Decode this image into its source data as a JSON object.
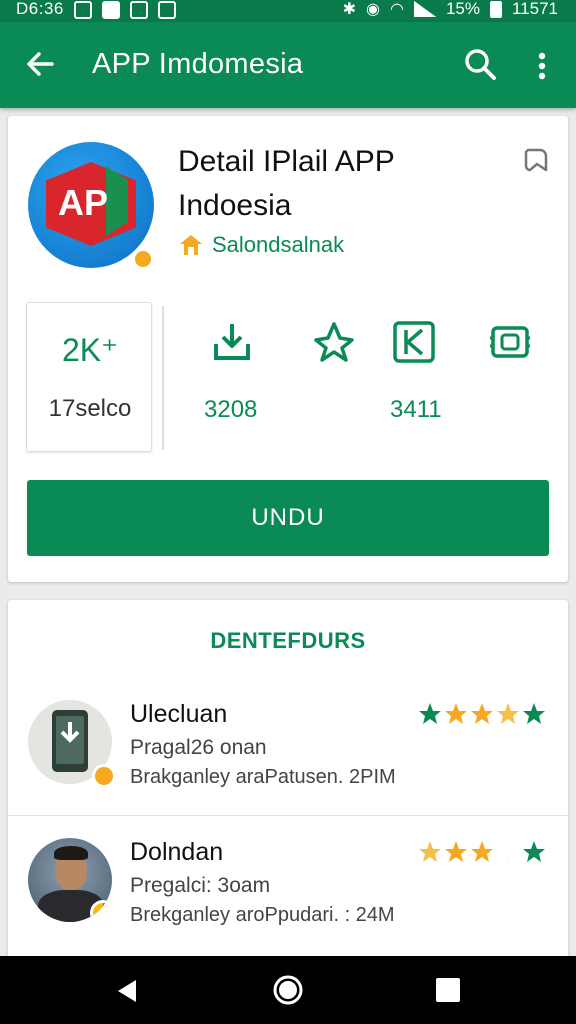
{
  "status_bar": {
    "time": "D6:36",
    "battery": "15%",
    "clock_right": "11571"
  },
  "app_bar": {
    "title": "APP Imdomesia"
  },
  "app": {
    "icon_text": "AP",
    "title": "Detail IPlail  APP Indoesia",
    "developer": "Salondsalnak",
    "install_label": "UNDU"
  },
  "stats": {
    "box_value": "2K⁺",
    "box_label": "17selco",
    "num1": "3208",
    "num2": "3411"
  },
  "reviews_section": {
    "title": "DENTEFDURS",
    "items": [
      {
        "name": "Ulecluan",
        "line1": "Pragal26 onan",
        "line2": "Brakganley araPatusen. 2PIM",
        "stars": 5
      },
      {
        "name": "Dolndan",
        "line1": "Pregalci: 3oam",
        "line2": "Brekganley aroPpudari. : 24M",
        "stars": 4
      }
    ]
  },
  "colors": {
    "primary": "#0a8a55",
    "status_bar": "#0b7a4b",
    "star_gold": "#f4a921",
    "star_green": "#0a8a55"
  },
  "icons": [
    "back-arrow-icon",
    "search-icon",
    "more-vert-icon",
    "bookmark-icon",
    "developer-badge-icon",
    "download-icon",
    "share-icon",
    "rating-icon",
    "screenshot-icon"
  ]
}
